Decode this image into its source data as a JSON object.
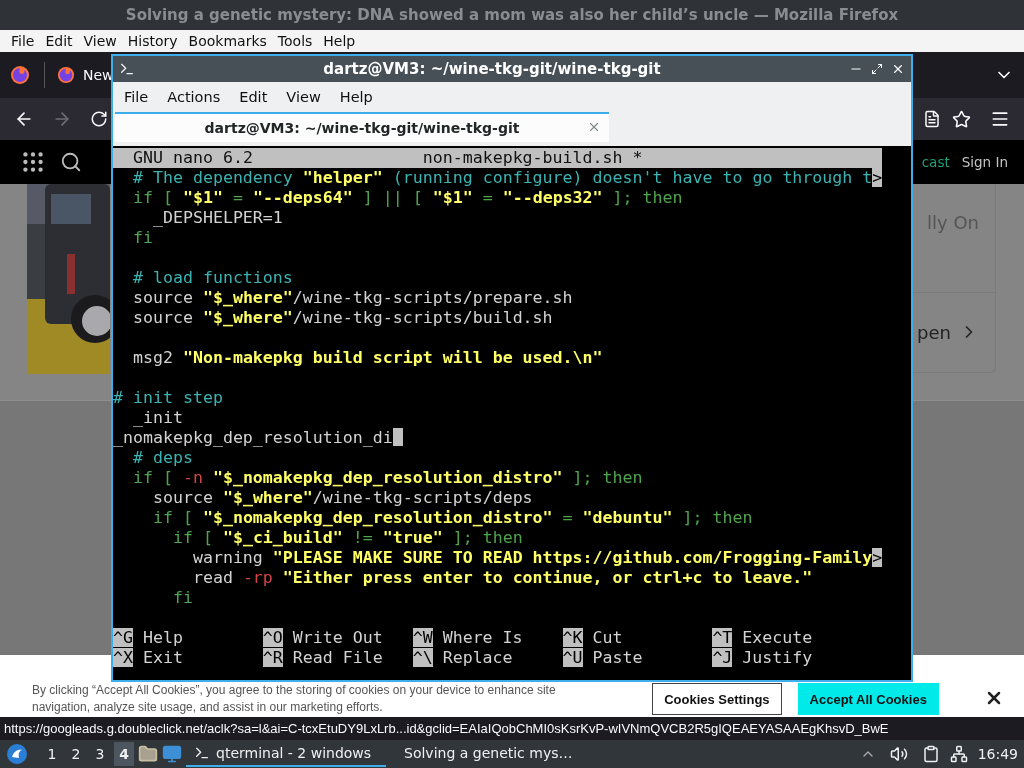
{
  "firefox": {
    "title": "Solving a genetic mystery: DNA showed a mom was also her child’s uncle — Mozilla Firefox",
    "menu": [
      "File",
      "Edit",
      "View",
      "History",
      "Bookmarks",
      "Tools",
      "Help"
    ],
    "tab": {
      "label": "New"
    },
    "nav": [
      {
        "kind": "back",
        "disabled": false
      },
      {
        "kind": "forward",
        "disabled": true
      },
      {
        "kind": "reload",
        "disabled": false
      }
    ],
    "site_links": [
      {
        "label": "cast",
        "color": "#1f9e7c"
      },
      {
        "label": "Sign In",
        "color": "#c4c4c4"
      }
    ],
    "card_texts": [
      "lly On",
      "pen"
    ],
    "cookie_banner": {
      "text": "By clicking “Accept All Cookies”, you agree to the storing of cookies on your device to enhance site navigation, analyze site usage, and assist in our marketing efforts.",
      "buttons": [
        {
          "label": "Cookies Settings",
          "kind": "secondary"
        },
        {
          "label": "Accept All Cookies",
          "kind": "primary"
        }
      ]
    },
    "status_url": "https://googleads.g.doubleclick.net/aclk?sa=l&ai=C-tcxEtuDY9LxLrb...id&gclid=EAIaIQobChMI0sKsrKvP-wIVNmQVCB2R5gIQEAEYASAAEgKhsvD_BwE"
  },
  "terminal": {
    "title": "dartz@VM3: ~/wine-tkg-git/wine-tkg-git",
    "menu": [
      "File",
      "Actions",
      "Edit",
      "View",
      "Help"
    ],
    "tab": {
      "label": "dartz@VM3: ~/wine-tkg-git/wine-tkg-git"
    },
    "nano": {
      "version": "GNU nano 6.2",
      "filename": "non-makepkg-build.sh *",
      "lines": [
        {
          "cursor": false,
          "segments": [
            {
              "text": "  # The dependency ",
              "kind": "comment"
            },
            {
              "text": "\"helper\"",
              "kind": "string"
            },
            {
              "text": " (running configure) doesn't have to go through t",
              "kind": "comment"
            },
            {
              "text": ">",
              "kind": "overflow"
            }
          ]
        },
        {
          "cursor": false,
          "segments": [
            {
              "text": "  if [ ",
              "kind": "keyword"
            },
            {
              "text": "\"$1\"",
              "kind": "string"
            },
            {
              "text": " = ",
              "kind": "keyword"
            },
            {
              "text": "\"--deps64\"",
              "kind": "string"
            },
            {
              "text": " ] || [ ",
              "kind": "keyword"
            },
            {
              "text": "\"$1\"",
              "kind": "string"
            },
            {
              "text": " = ",
              "kind": "keyword"
            },
            {
              "text": "\"--deps32\"",
              "kind": "string"
            },
            {
              "text": " ]; then",
              "kind": "keyword"
            }
          ]
        },
        {
          "cursor": false,
          "segments": [
            {
              "text": "    _DEPSHELPER=1",
              "kind": "plain"
            }
          ]
        },
        {
          "cursor": false,
          "segments": [
            {
              "text": "  fi",
              "kind": "keyword"
            }
          ]
        },
        {
          "cursor": false
        },
        {
          "cursor": false,
          "segments": [
            {
              "text": "  # load functions",
              "kind": "comment"
            }
          ]
        },
        {
          "cursor": false,
          "segments": [
            {
              "text": "  source ",
              "kind": "plain"
            },
            {
              "text": "\"$_where\"",
              "kind": "string"
            },
            {
              "text": "/wine-tkg-scripts/prepare.sh",
              "kind": "plain"
            }
          ]
        },
        {
          "cursor": false,
          "segments": [
            {
              "text": "  source ",
              "kind": "plain"
            },
            {
              "text": "\"$_where\"",
              "kind": "string"
            },
            {
              "text": "/wine-tkg-scripts/build.sh",
              "kind": "plain"
            }
          ]
        },
        {
          "cursor": false
        },
        {
          "cursor": false,
          "segments": [
            {
              "text": "  msg2 ",
              "kind": "plain"
            },
            {
              "text": "\"Non-makepkg build script will be used.\\n\"",
              "kind": "string"
            }
          ]
        },
        {
          "cursor": false
        },
        {
          "cursor": false,
          "segments": [
            {
              "text": "# init step",
              "kind": "comment"
            }
          ]
        },
        {
          "cursor": false,
          "segments": [
            {
              "text": "  _init",
              "kind": "plain"
            }
          ]
        },
        {
          "cursor": true,
          "segments": [
            {
              "text": "_nomakepkg_dep_resolution_di",
              "kind": "plain"
            }
          ]
        },
        {
          "cursor": false,
          "segments": [
            {
              "text": "  # deps",
              "kind": "comment"
            }
          ]
        },
        {
          "cursor": false,
          "segments": [
            {
              "text": "  if [ ",
              "kind": "keyword"
            },
            {
              "text": "-n",
              "kind": "option"
            },
            {
              "text": " \"$_nomakepkg_dep_resolution_distro\"",
              "kind": "string"
            },
            {
              "text": " ]; then",
              "kind": "keyword"
            }
          ]
        },
        {
          "cursor": false,
          "segments": [
            {
              "text": "    source ",
              "kind": "plain"
            },
            {
              "text": "\"$_where\"",
              "kind": "string"
            },
            {
              "text": "/wine-tkg-scripts/deps",
              "kind": "plain"
            }
          ]
        },
        {
          "cursor": false,
          "segments": [
            {
              "text": "    if [ ",
              "kind": "keyword"
            },
            {
              "text": "\"$_nomakepkg_dep_resolution_distro\"",
              "kind": "string"
            },
            {
              "text": " = ",
              "kind": "keyword"
            },
            {
              "text": "\"debuntu\"",
              "kind": "string"
            },
            {
              "text": " ]; then",
              "kind": "keyword"
            }
          ]
        },
        {
          "cursor": false,
          "segments": [
            {
              "text": "      if [ ",
              "kind": "keyword"
            },
            {
              "text": "\"$_ci_build\"",
              "kind": "string"
            },
            {
              "text": " != ",
              "kind": "keyword"
            },
            {
              "text": "\"true\"",
              "kind": "string"
            },
            {
              "text": " ]; then",
              "kind": "keyword"
            }
          ]
        },
        {
          "cursor": false,
          "segments": [
            {
              "text": "        warning ",
              "kind": "plain"
            },
            {
              "text": "\"PLEASE MAKE SURE TO READ https://github.com/Frogging-Family",
              "kind": "string"
            },
            {
              "text": ">",
              "kind": "overflow"
            }
          ]
        },
        {
          "cursor": false,
          "segments": [
            {
              "text": "        read ",
              "kind": "plain"
            },
            {
              "text": "-rp",
              "kind": "option"
            },
            {
              "text": " \"Either press enter to continue, or ctrl+c to leave.\"",
              "kind": "string"
            }
          ]
        },
        {
          "cursor": false,
          "segments": [
            {
              "text": "      fi",
              "kind": "keyword"
            }
          ]
        },
        {
          "cursor": false
        }
      ],
      "shortcuts": [
        [
          {
            "key": "^G",
            "label": "Help"
          },
          {
            "key": "^O",
            "label": "Write Out"
          },
          {
            "key": "^W",
            "label": "Where Is"
          },
          {
            "key": "^K",
            "label": "Cut"
          },
          {
            "key": "^T",
            "label": "Execute"
          }
        ],
        [
          {
            "key": "^X",
            "label": "Exit"
          },
          {
            "key": "^R",
            "label": "Read File"
          },
          {
            "key": "^\\",
            "label": "Replace"
          },
          {
            "key": "^U",
            "label": "Paste"
          },
          {
            "key": "^J",
            "label": "Justify"
          }
        ]
      ]
    }
  },
  "taskbar": {
    "workspaces": [
      {
        "label": "1",
        "selected": false
      },
      {
        "label": "2",
        "selected": false
      },
      {
        "label": "3",
        "selected": false
      },
      {
        "label": "4",
        "selected": true
      }
    ],
    "tasks": [
      {
        "label": "qterminal - 2 windows",
        "kind": "terminal",
        "selected": true
      },
      {
        "label": "Solving a genetic mys…",
        "kind": "browser",
        "selected": false
      }
    ],
    "clock": "16:49"
  }
}
